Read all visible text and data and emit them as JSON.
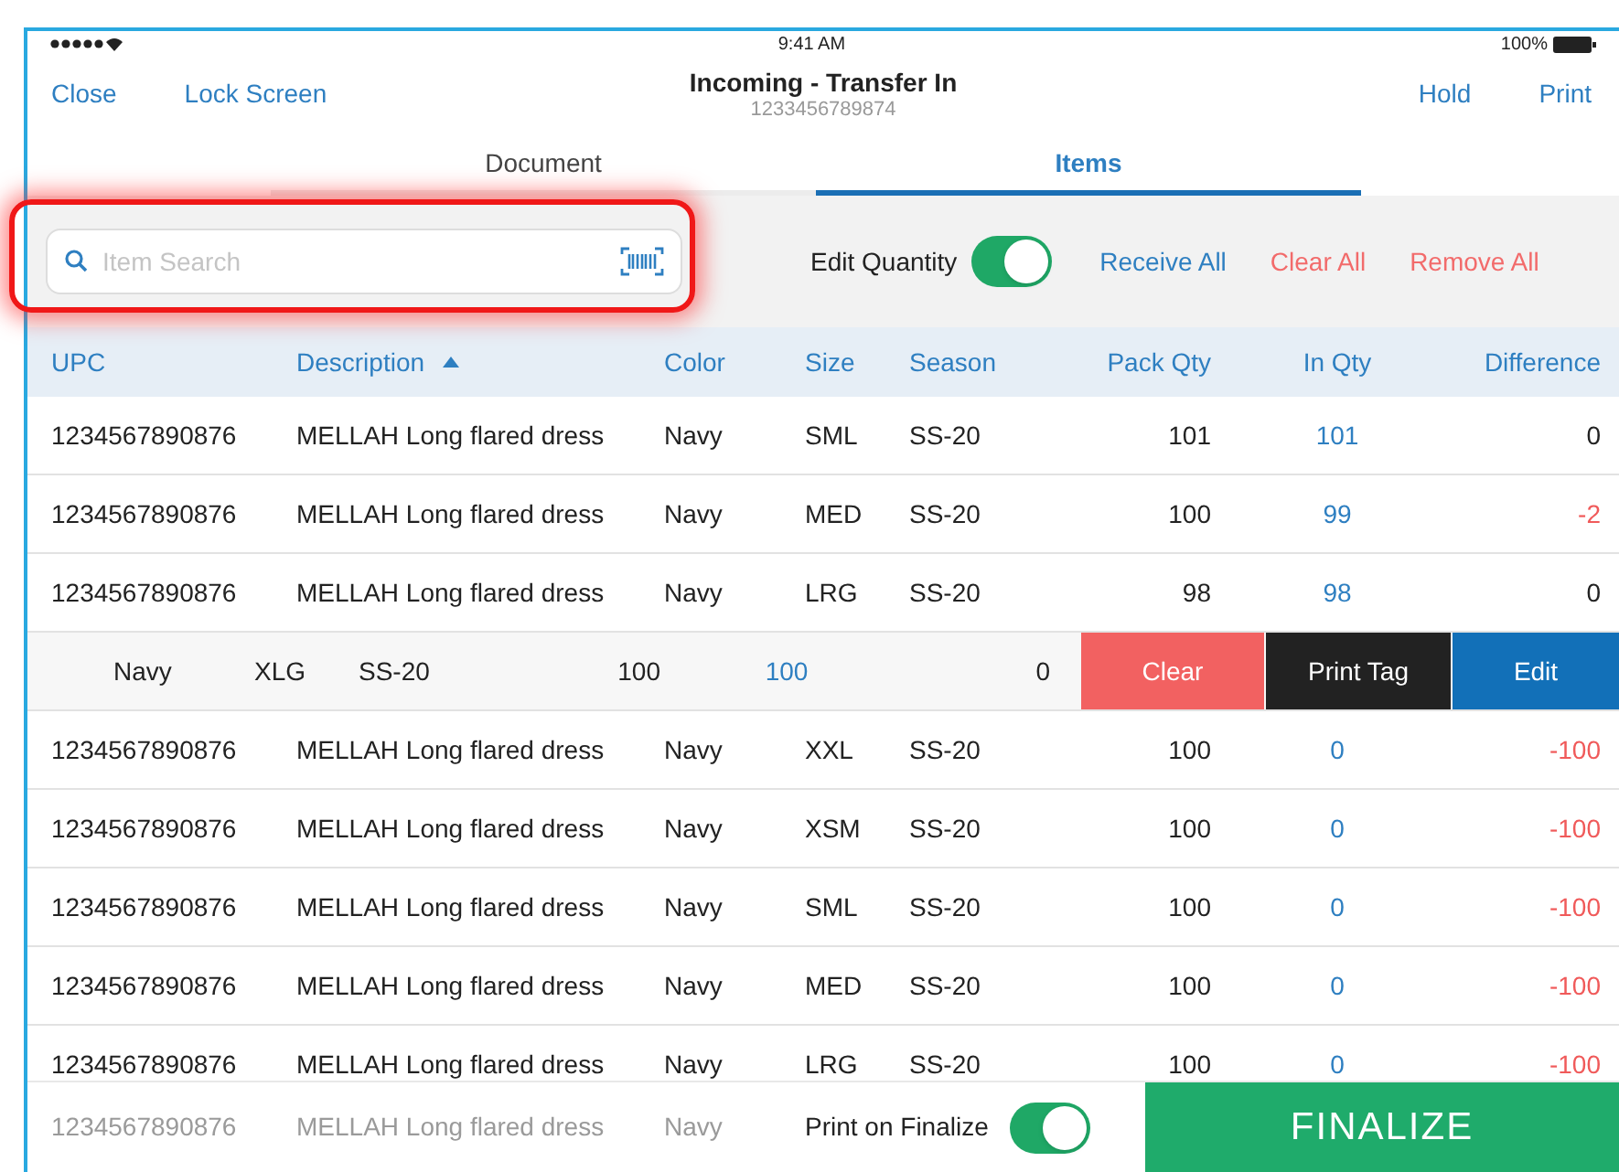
{
  "status_bar": {
    "time": "9:41 AM",
    "battery": "100%"
  },
  "header": {
    "title": "Incoming - Transfer In",
    "subtitle": "1233456789874",
    "left_buttons": [
      "Close",
      "Lock Screen"
    ],
    "right_buttons": [
      "Hold",
      "Print"
    ]
  },
  "tabs": [
    {
      "label": "Document",
      "selected": false
    },
    {
      "label": "Items",
      "selected": true
    }
  ],
  "search": {
    "placeholder": "Item Search",
    "highlighted": true
  },
  "edit_quantity": {
    "label": "Edit Quantity",
    "on": true
  },
  "actions": [
    {
      "label": "Receive All",
      "kind": "primary"
    },
    {
      "label": "Clear All",
      "kind": "danger"
    },
    {
      "label": "Remove All",
      "kind": "danger"
    }
  ],
  "table": {
    "columns": [
      {
        "label": "UPC",
        "kind": "plain"
      },
      {
        "label": "Description",
        "kind": "sorted_ascending"
      },
      {
        "label": "Color",
        "kind": "plain"
      },
      {
        "label": "Size",
        "kind": "plain"
      },
      {
        "label": "Season",
        "kind": "plain"
      },
      {
        "label": "Pack Qty",
        "kind": "plain"
      },
      {
        "label": "In Qty",
        "kind": "plain"
      },
      {
        "label": "Difference",
        "kind": "plain"
      }
    ],
    "rows": [
      {
        "kind": "normal",
        "upc": "1234567890876",
        "description": "MELLAH Long flared dress",
        "item_color": "Navy",
        "size": "SML",
        "season": "SS-20",
        "pack_qty": "101",
        "in_qty": "101",
        "difference": "0",
        "negative": false
      },
      {
        "kind": "normal",
        "upc": "1234567890876",
        "description": "MELLAH Long flared dress",
        "item_color": "Navy",
        "size": "MED",
        "season": "SS-20",
        "pack_qty": "100",
        "in_qty": "99",
        "difference": "-2",
        "negative": true
      },
      {
        "kind": "normal",
        "upc": "1234567890876",
        "description": "MELLAH Long flared dress",
        "item_color": "Navy",
        "size": "LRG",
        "season": "SS-20",
        "pack_qty": "98",
        "in_qty": "98",
        "difference": "0",
        "negative": false
      },
      {
        "kind": "swiped",
        "shifted_cells": {
          "item_color": "Navy",
          "size": "XLG",
          "season": "SS-20",
          "pack_qty": "100",
          "in_qty": "100",
          "difference": "0",
          "negative": false
        },
        "row_actions": [
          {
            "label": "Clear",
            "kind": "clear"
          },
          {
            "label": "Print Tag",
            "kind": "print"
          },
          {
            "label": "Edit",
            "kind": "edit"
          }
        ]
      },
      {
        "kind": "normal",
        "upc": "1234567890876",
        "description": "MELLAH Long flared dress",
        "item_color": "Navy",
        "size": "XXL",
        "season": "SS-20",
        "pack_qty": "100",
        "in_qty": "0",
        "difference": "-100",
        "negative": true
      },
      {
        "kind": "normal",
        "upc": "1234567890876",
        "description": "MELLAH Long flared dress",
        "item_color": "Navy",
        "size": "XSM",
        "season": "SS-20",
        "pack_qty": "100",
        "in_qty": "0",
        "difference": "-100",
        "negative": true
      },
      {
        "kind": "normal",
        "upc": "1234567890876",
        "description": "MELLAH Long flared dress",
        "item_color": "Navy",
        "size": "SML",
        "season": "SS-20",
        "pack_qty": "100",
        "in_qty": "0",
        "difference": "-100",
        "negative": true
      },
      {
        "kind": "normal",
        "upc": "1234567890876",
        "description": "MELLAH Long flared dress",
        "item_color": "Navy",
        "size": "MED",
        "season": "SS-20",
        "pack_qty": "100",
        "in_qty": "0",
        "difference": "-100",
        "negative": true
      },
      {
        "kind": "normal",
        "upc": "1234567890876",
        "description": "MELLAH Long flared dress",
        "item_color": "Navy",
        "size": "LRG",
        "season": "SS-20",
        "pack_qty": "100",
        "in_qty": "0",
        "difference": "-100",
        "negative": true
      }
    ]
  },
  "footer": {
    "faded_row": {
      "upc": "1234567890876",
      "description": "MELLAH Long flared dress",
      "item_color": "Navy"
    },
    "print_on_finalize": {
      "label": "Print on Finalize",
      "on": true
    },
    "finalize": "FINALIZE"
  }
}
